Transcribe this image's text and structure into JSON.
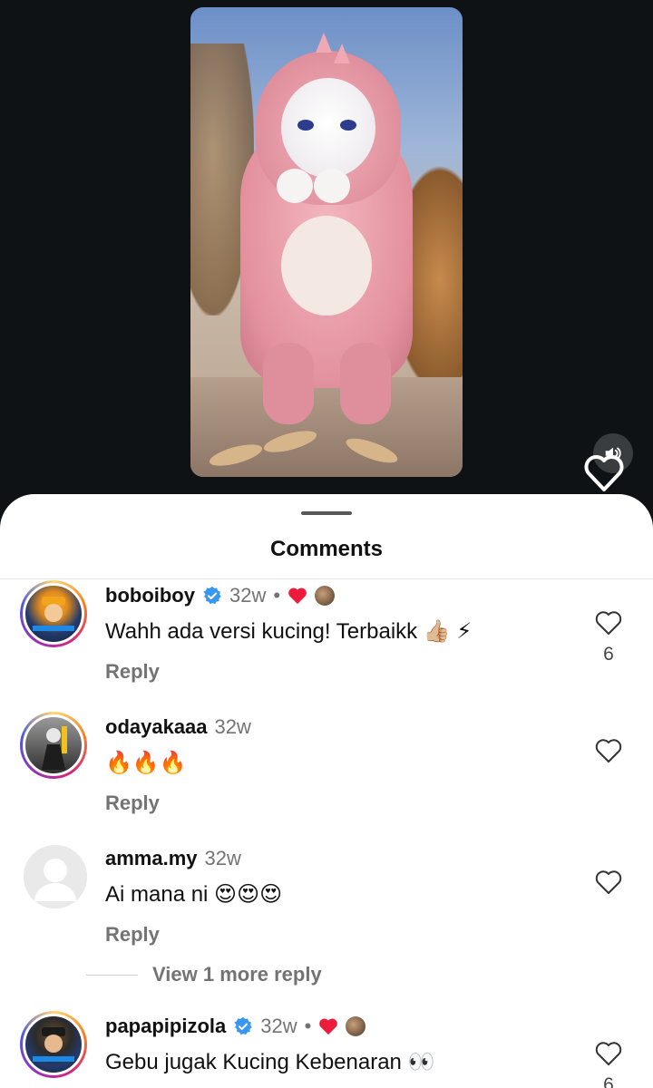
{
  "sheet": {
    "title": "Comments"
  },
  "view_more": "View 1 more reply",
  "comments": [
    {
      "username": "boboiboy",
      "verified": true,
      "time": "32w",
      "separator": "•",
      "text": "Wahh ada versi kucing! Terbaikk 👍🏼 ⚡",
      "reply": "Reply",
      "likes": "6",
      "creator_liked": true
    },
    {
      "username": "odayakaaa",
      "verified": false,
      "time": "32w",
      "separator": "",
      "text": "🔥🔥🔥",
      "reply": "Reply",
      "likes": "",
      "creator_liked": false
    },
    {
      "username": "amma.my",
      "verified": false,
      "time": "32w",
      "separator": "",
      "text": "Ai mana ni 😍😍😍",
      "reply": "Reply",
      "likes": "",
      "creator_liked": false
    },
    {
      "username": "papapipizola",
      "verified": true,
      "time": "32w",
      "separator": "•",
      "text": "Gebu jugak Kucing Kebenaran 👀",
      "reply": "",
      "likes": "6",
      "creator_liked": true
    }
  ],
  "icons": {
    "sound": "speaker-icon",
    "heart": "heart-outline-icon",
    "verified": "verified-badge-icon"
  },
  "colors": {
    "verified": "#3897f0",
    "liked_heart": "#ed1c3b",
    "secondary_text": "#737373"
  }
}
